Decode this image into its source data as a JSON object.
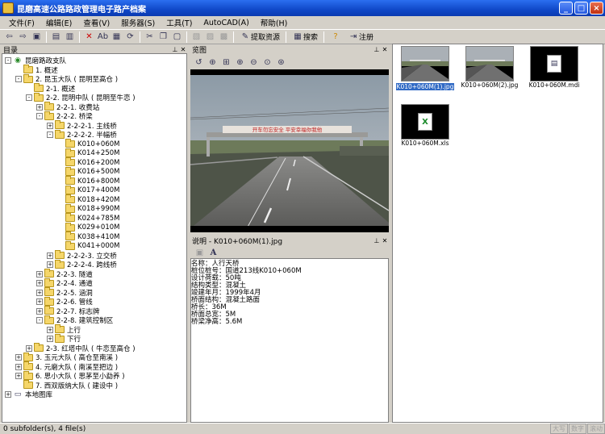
{
  "window": {
    "title": "昆磨高速公路路政管理电子路产档案"
  },
  "menu": [
    "文件(F)",
    "编辑(E)",
    "查看(V)",
    "服务器(S)",
    "工具(T)",
    "AutoCAD(A)",
    "帮助(H)"
  ],
  "toolbar": {
    "extract_label": "提取资源",
    "search_label": "搜索",
    "logout_label": "注册"
  },
  "tree_panel": {
    "title": "目录"
  },
  "tree": [
    {
      "label": "昆磨路政支队",
      "expanded": true,
      "icon": "network-icon"
    },
    {
      "label": "1. 概述"
    },
    {
      "label": "2. 昆玉大队 ( 昆明至高仓 )",
      "expanded": true
    },
    {
      "label": "2-1. 概述"
    },
    {
      "label": "2-2. 昆明中队 ( 昆明至牛恋 )",
      "expanded": true
    },
    {
      "label": "2-2-1. 收费站"
    },
    {
      "label": "2-2-2. 桥梁",
      "expanded": true
    },
    {
      "label": "2-2-2-1. 主线桥"
    },
    {
      "label": "2-2-2-2. 半幅桥",
      "expanded": true
    },
    {
      "label": "K010+060M"
    },
    {
      "label": "K014+250M"
    },
    {
      "label": "K016+200M"
    },
    {
      "label": "K016+500M"
    },
    {
      "label": "K016+800M"
    },
    {
      "label": "K017+400M"
    },
    {
      "label": "K018+420M"
    },
    {
      "label": "K018+990M"
    },
    {
      "label": "K024+785M"
    },
    {
      "label": "K029+010M"
    },
    {
      "label": "K038+410M"
    },
    {
      "label": "K041+000M"
    },
    {
      "label": "2-2-2-3. 立交桥"
    },
    {
      "label": "2-2-2-4. 跨线桥"
    },
    {
      "label": "2-2-3. 隧道"
    },
    {
      "label": "2-2-4. 通道"
    },
    {
      "label": "2-2-5. 涵洞"
    },
    {
      "label": "2-2-6. 管线"
    },
    {
      "label": "2-2-7. 标志牌"
    },
    {
      "label": "2-2-8. 建筑控制区",
      "expanded": true
    },
    {
      "label": "上行"
    },
    {
      "label": "下行"
    },
    {
      "label": "2-3. 红塔中队 ( 牛恋至高仓 )"
    },
    {
      "label": "3. 玉元大队 ( 高仓至南溪 )"
    },
    {
      "label": "4. 元磨大队 ( 南溪至把边 )"
    },
    {
      "label": "6. 思小大队 ( 思茅至小勐养 )"
    },
    {
      "label": "7. 西双版纳大队 ( 建设中 )"
    },
    {
      "label": "本地图库",
      "icon": "computer-icon"
    }
  ],
  "preview_panel": {
    "title": "览图"
  },
  "desc_panel": {
    "title": "说明 - K010+060M(1).jpg"
  },
  "desc_lines": [
    "名称：人行天桥",
    "桩位桩号：国道213线K010+060M",
    "设计荷载：50吨",
    "结构类型：混凝土",
    "竣建年月：1999年4月",
    "桥面结构：混凝土路面",
    "桥长：36M",
    "桥面总宽：5M",
    "桥梁净高：5.6M"
  ],
  "files": [
    {
      "name": "K010+060M(1).jpg",
      "type": "photo",
      "selected": true
    },
    {
      "name": "K010+060M(2).jpg",
      "type": "photo"
    },
    {
      "name": "K010+060M.mdi",
      "type": "mdi"
    },
    {
      "name": "K010+060M.xls",
      "type": "xls"
    }
  ],
  "photo_banner": "开车勿忘安全 平安幸福你我他",
  "status": {
    "text": "0 subfolder(s), 4 file(s)",
    "indicators": [
      "大写",
      "数字",
      "滚动"
    ]
  }
}
